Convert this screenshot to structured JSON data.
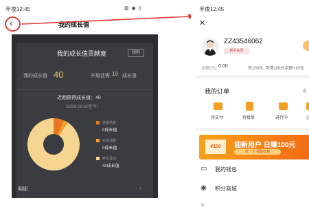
{
  "colors": {
    "accent_red": "#e53935",
    "gold": "#f0c269",
    "orange": "#f4a024",
    "dark_panel": "#2c2d31"
  },
  "left_screen": {
    "status_time": "半夜12:45",
    "status_icons": "▥ ◉ ▯",
    "back_icon": "chevron-left-icon",
    "title": "我的成长值",
    "card": {
      "title": "我的成长值贡献度",
      "rule_button": "规则",
      "my_growth_label": "我的成长值",
      "my_growth_value": "40",
      "upgrade_label": "升级还需",
      "upgrade_value": "10",
      "upgrade_suffix": "成长值",
      "recent_text": "近期获得成长值：40",
      "date_range": "（2019-09-30至今）",
      "detail_label": "明细",
      "detail_arrow": "›"
    },
    "chart_data": {
      "type": "pie",
      "categories": [
        "完善信息",
        "充值消费",
        "参与互动"
      ],
      "values": [
        0,
        0,
        40
      ],
      "value_labels": [
        "0成长值",
        "0成长值",
        "40成长值"
      ],
      "colors": [
        "#e87722",
        "#f4a024",
        "#f5d590"
      ]
    }
  },
  "right_screen": {
    "status_time": "半夜12:45",
    "close_icon": "✕",
    "username": "ZZ43546062",
    "member_badge": "新手会员",
    "balance_label": "余额(元):",
    "balance_value": "0.00",
    "recharge_text": "充100元, 可得100元余额+10元",
    "orders_title": "我的订单",
    "orders_more": "查",
    "order_items": [
      {
        "label": "待支付"
      },
      {
        "label": "待接单"
      },
      {
        "label": "进行中"
      },
      {
        "label": "已"
      }
    ],
    "promo": {
      "coupon": "¥100",
      "title": "迎新用户 日赚100元",
      "subtitle": "点一下 领取红包"
    },
    "menu_items": [
      {
        "icon": "wallet-icon",
        "glyph": "▭",
        "label": "我的钱包"
      },
      {
        "icon": "points-mall-icon",
        "glyph": "◉",
        "label": "积分商城"
      },
      {
        "icon": "more-icon",
        "glyph": "○",
        "label": ""
      }
    ]
  }
}
